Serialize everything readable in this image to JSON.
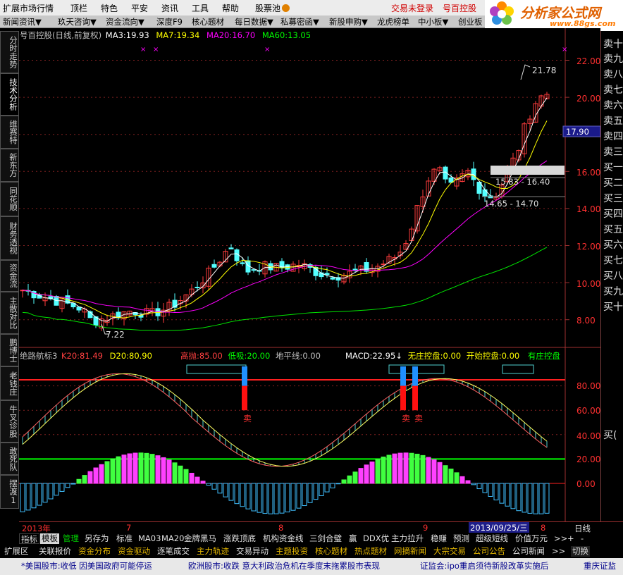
{
  "menubar": {
    "items": [
      "扩展市场行情",
      "顶栏",
      "特色",
      "平安",
      "资讯",
      "工具",
      "帮助"
    ],
    "stock_pool": "股票池",
    "login_status": "交易未登录",
    "stock_name": "号百控股"
  },
  "logo": {
    "title": "分析家公式网",
    "url": "www.88gs.com"
  },
  "toolbar": {
    "items": [
      "新闻资讯▼",
      "玖天咨询▼",
      "资金流向▼",
      "深度F9",
      "核心题材",
      "每日数据▼",
      "私募密函▼",
      "新股申购▼",
      "龙虎榜单",
      "中小板▼",
      "创业板"
    ]
  },
  "left_tabs": [
    "分时走势",
    "技术分析",
    "维赛特",
    "新东方",
    "同花顺",
    "财务透视",
    "资金流",
    "主散对比",
    "鹏博士",
    "老钱庄",
    "牛叉诊股",
    "敢死队",
    "摆渡1"
  ],
  "main_chart": {
    "header": {
      "title": "号百控股(日线,前复权)",
      "ma3_label": "MA3:",
      "ma3_value": "19.93",
      "ma7_label": "MA7:",
      "ma7_value": "19.34",
      "ma20_label": "MA20:",
      "ma20_value": "16.70",
      "ma60_label": "MA60:",
      "ma60_value": "13.05"
    },
    "annotations": {
      "high": "21.78",
      "low": "7.22",
      "range1": "15.83 - 16.40",
      "range2": "14.65 - 14.70"
    },
    "current_price": "17.90",
    "y_ticks": [
      "22.00",
      "20.00",
      "18.00",
      "16.00",
      "14.00",
      "12.00",
      "10.00",
      "8.00"
    ]
  },
  "indicator_chart": {
    "header": {
      "name": "绝路航标3",
      "k20_label": "K20:",
      "k20_value": "81.49",
      "d20_label": "D20:",
      "d20_value": "80.90",
      "high_label": "高抛:",
      "high_value": "85.00",
      "low_label": "低吸:",
      "low_value": "20.00",
      "level_label": "地平线:",
      "level_value": "0.00",
      "macd_label": "MACD:",
      "macd_value": "22.95",
      "no_ctrl_label": "无庄控盘:",
      "no_ctrl_value": "0.00",
      "start_ctrl_label": "开始控盘:",
      "start_ctrl_value": "0.00",
      "ctrl_label": "有庄控盘"
    },
    "sell_label": "卖",
    "y_ticks": [
      "80.00",
      "60.00",
      "40.00",
      "20.00",
      "0.00"
    ]
  },
  "time_axis": {
    "year": "2013年",
    "m7": "7",
    "m8": "8",
    "m9": "9",
    "cursor_date": "2013/09/25/三",
    "m8b": "8",
    "period": "日线"
  },
  "right_panel": {
    "sell_labels": [
      "卖十",
      "卖九",
      "卖八",
      "卖七",
      "卖六",
      "卖五",
      "卖四",
      "卖三",
      "卖二",
      "卖一"
    ],
    "buy_labels": [
      "买一",
      "买二",
      "买三",
      "买四",
      "买五",
      "买六",
      "买七",
      "买八",
      "买九",
      "买十"
    ],
    "bottom_label": "买("
  },
  "bottom_tabs_1": [
    "指标",
    "模板",
    "管理",
    "另存为",
    "标准",
    "MA03",
    "MA20",
    "金牌黑马",
    "涨跌顶底",
    "机构资金线",
    "三剑合璧",
    "赢",
    "DDX优",
    "主力拉升",
    "稳赚",
    "预测",
    "超级短线",
    "价值万元",
    ">>"
  ],
  "bottom_tabs_2": [
    "扩展区",
    "关联报价",
    "资金分布",
    "资金驱动",
    "逐笔成交",
    "主力轨迹",
    "交易异动",
    "主题投资",
    "核心题材",
    "热点题材",
    "网摘新闻",
    "大宗交易",
    "公司公告",
    "公司新闻",
    ">>"
  ],
  "bottom_right": {
    "switch": "切",
    "convert": "换",
    "plus": "+",
    "minus": "-"
  },
  "ticker": [
    "*美国股市:收低 因美国政府可能停运",
    "欧洲股市:收跌 意大利政治危机在季度末拖累股市表现",
    "证监会:ipo重启须待新股改革实施后",
    "重庆证监"
  ],
  "colors": {
    "up": "#ff3c3c",
    "down": "#54ffff",
    "ma3": "#ffffff",
    "ma7": "#ffff00",
    "ma20": "#ff00ff",
    "ma60": "#00e600"
  }
}
